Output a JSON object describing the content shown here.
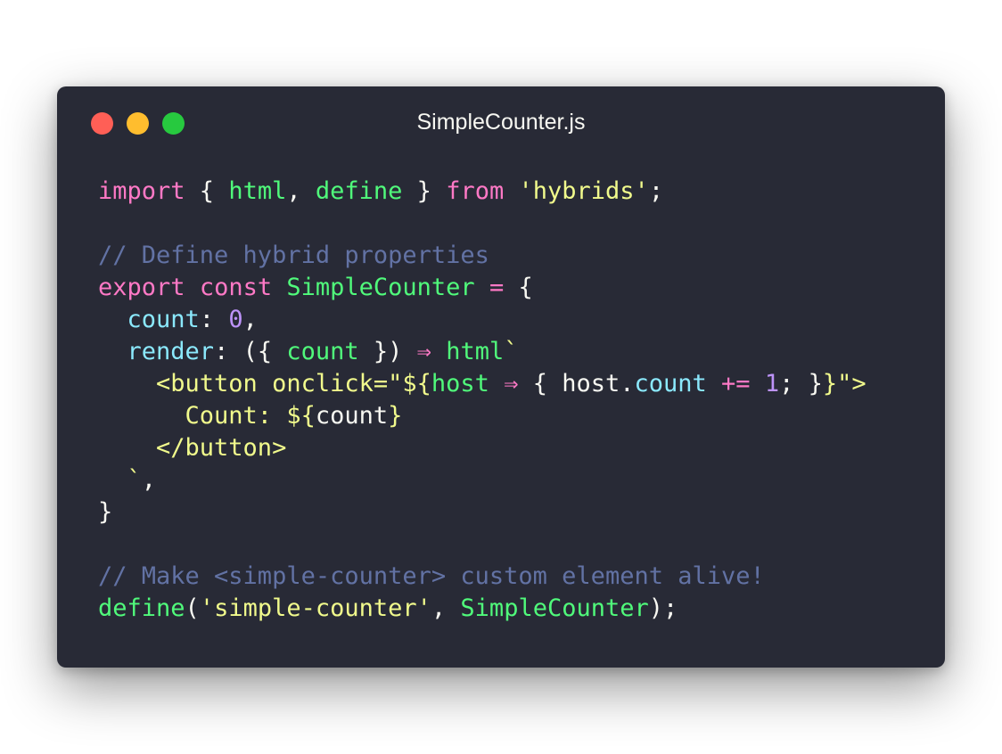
{
  "window": {
    "title": "SimpleCounter.js",
    "traffic_lights": [
      {
        "name": "close",
        "color": "#ff5f56"
      },
      {
        "name": "minimize",
        "color": "#ffbd2e"
      },
      {
        "name": "zoom",
        "color": "#27c93f"
      }
    ],
    "background": "#282a36"
  },
  "colors": {
    "keyword": "#ff79c6",
    "func": "#50fa7b",
    "string": "#f1fa8c",
    "comment": "#6272a4",
    "prop": "#8be9fd",
    "number": "#bd93f9",
    "plain": "#f8f8f2"
  },
  "code": {
    "lines": [
      [
        {
          "t": "import",
          "c": "keyword"
        },
        {
          "t": " { ",
          "c": "plain"
        },
        {
          "t": "html",
          "c": "func"
        },
        {
          "t": ", ",
          "c": "plain"
        },
        {
          "t": "define",
          "c": "func"
        },
        {
          "t": " } ",
          "c": "plain"
        },
        {
          "t": "from",
          "c": "keyword"
        },
        {
          "t": " ",
          "c": "plain"
        },
        {
          "t": "'hybrids'",
          "c": "string"
        },
        {
          "t": ";",
          "c": "plain"
        }
      ],
      [],
      [
        {
          "t": "// Define hybrid properties",
          "c": "comment"
        }
      ],
      [
        {
          "t": "export",
          "c": "keyword"
        },
        {
          "t": " ",
          "c": "plain"
        },
        {
          "t": "const",
          "c": "keyword"
        },
        {
          "t": " ",
          "c": "plain"
        },
        {
          "t": "SimpleCounter",
          "c": "func"
        },
        {
          "t": " ",
          "c": "plain"
        },
        {
          "t": "=",
          "c": "op"
        },
        {
          "t": " {",
          "c": "plain"
        }
      ],
      [
        {
          "t": "  ",
          "c": "plain"
        },
        {
          "t": "count",
          "c": "prop"
        },
        {
          "t": ": ",
          "c": "plain"
        },
        {
          "t": "0",
          "c": "number"
        },
        {
          "t": ",",
          "c": "plain"
        }
      ],
      [
        {
          "t": "  ",
          "c": "plain"
        },
        {
          "t": "render",
          "c": "prop"
        },
        {
          "t": ": ({ ",
          "c": "plain"
        },
        {
          "t": "count",
          "c": "func"
        },
        {
          "t": " }) ",
          "c": "plain"
        },
        {
          "t": "⇒",
          "c": "op"
        },
        {
          "t": " ",
          "c": "plain"
        },
        {
          "t": "html",
          "c": "func"
        },
        {
          "t": "`",
          "c": "string"
        }
      ],
      [
        {
          "t": "    <button onclick=\"",
          "c": "string"
        },
        {
          "t": "${",
          "c": "string"
        },
        {
          "t": "host",
          "c": "func"
        },
        {
          "t": " ",
          "c": "plain"
        },
        {
          "t": "⇒",
          "c": "op"
        },
        {
          "t": " { host.",
          "c": "plain"
        },
        {
          "t": "count",
          "c": "prop"
        },
        {
          "t": " ",
          "c": "plain"
        },
        {
          "t": "+=",
          "c": "op"
        },
        {
          "t": " ",
          "c": "plain"
        },
        {
          "t": "1",
          "c": "number"
        },
        {
          "t": "; }",
          "c": "plain"
        },
        {
          "t": "}\">",
          "c": "string"
        }
      ],
      [
        {
          "t": "      Count: ${",
          "c": "string"
        },
        {
          "t": "count",
          "c": "plain"
        },
        {
          "t": "}",
          "c": "string"
        }
      ],
      [
        {
          "t": "    </button>",
          "c": "string"
        }
      ],
      [
        {
          "t": "  `",
          "c": "string"
        },
        {
          "t": ",",
          "c": "plain"
        }
      ],
      [
        {
          "t": "}",
          "c": "plain"
        }
      ],
      [],
      [
        {
          "t": "// Make <simple-counter> custom element alive!",
          "c": "comment"
        }
      ],
      [
        {
          "t": "define",
          "c": "func"
        },
        {
          "t": "(",
          "c": "plain"
        },
        {
          "t": "'simple-counter'",
          "c": "string"
        },
        {
          "t": ", ",
          "c": "plain"
        },
        {
          "t": "SimpleCounter",
          "c": "func"
        },
        {
          "t": ");",
          "c": "plain"
        }
      ]
    ]
  }
}
